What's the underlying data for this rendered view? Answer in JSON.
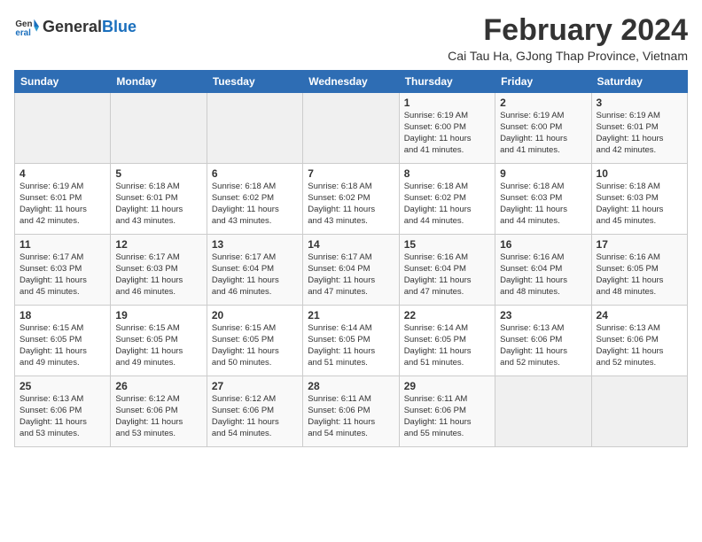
{
  "logo": {
    "general": "General",
    "blue": "Blue"
  },
  "title": "February 2024",
  "subtitle": "Cai Tau Ha, GJong Thap Province, Vietnam",
  "days_of_week": [
    "Sunday",
    "Monday",
    "Tuesday",
    "Wednesday",
    "Thursday",
    "Friday",
    "Saturday"
  ],
  "weeks": [
    [
      {
        "day": "",
        "info": ""
      },
      {
        "day": "",
        "info": ""
      },
      {
        "day": "",
        "info": ""
      },
      {
        "day": "",
        "info": ""
      },
      {
        "day": "1",
        "info": "Sunrise: 6:19 AM\nSunset: 6:00 PM\nDaylight: 11 hours\nand 41 minutes."
      },
      {
        "day": "2",
        "info": "Sunrise: 6:19 AM\nSunset: 6:00 PM\nDaylight: 11 hours\nand 41 minutes."
      },
      {
        "day": "3",
        "info": "Sunrise: 6:19 AM\nSunset: 6:01 PM\nDaylight: 11 hours\nand 42 minutes."
      }
    ],
    [
      {
        "day": "4",
        "info": "Sunrise: 6:19 AM\nSunset: 6:01 PM\nDaylight: 11 hours\nand 42 minutes."
      },
      {
        "day": "5",
        "info": "Sunrise: 6:18 AM\nSunset: 6:01 PM\nDaylight: 11 hours\nand 43 minutes."
      },
      {
        "day": "6",
        "info": "Sunrise: 6:18 AM\nSunset: 6:02 PM\nDaylight: 11 hours\nand 43 minutes."
      },
      {
        "day": "7",
        "info": "Sunrise: 6:18 AM\nSunset: 6:02 PM\nDaylight: 11 hours\nand 43 minutes."
      },
      {
        "day": "8",
        "info": "Sunrise: 6:18 AM\nSunset: 6:02 PM\nDaylight: 11 hours\nand 44 minutes."
      },
      {
        "day": "9",
        "info": "Sunrise: 6:18 AM\nSunset: 6:03 PM\nDaylight: 11 hours\nand 44 minutes."
      },
      {
        "day": "10",
        "info": "Sunrise: 6:18 AM\nSunset: 6:03 PM\nDaylight: 11 hours\nand 45 minutes."
      }
    ],
    [
      {
        "day": "11",
        "info": "Sunrise: 6:17 AM\nSunset: 6:03 PM\nDaylight: 11 hours\nand 45 minutes."
      },
      {
        "day": "12",
        "info": "Sunrise: 6:17 AM\nSunset: 6:03 PM\nDaylight: 11 hours\nand 46 minutes."
      },
      {
        "day": "13",
        "info": "Sunrise: 6:17 AM\nSunset: 6:04 PM\nDaylight: 11 hours\nand 46 minutes."
      },
      {
        "day": "14",
        "info": "Sunrise: 6:17 AM\nSunset: 6:04 PM\nDaylight: 11 hours\nand 47 minutes."
      },
      {
        "day": "15",
        "info": "Sunrise: 6:16 AM\nSunset: 6:04 PM\nDaylight: 11 hours\nand 47 minutes."
      },
      {
        "day": "16",
        "info": "Sunrise: 6:16 AM\nSunset: 6:04 PM\nDaylight: 11 hours\nand 48 minutes."
      },
      {
        "day": "17",
        "info": "Sunrise: 6:16 AM\nSunset: 6:05 PM\nDaylight: 11 hours\nand 48 minutes."
      }
    ],
    [
      {
        "day": "18",
        "info": "Sunrise: 6:15 AM\nSunset: 6:05 PM\nDaylight: 11 hours\nand 49 minutes."
      },
      {
        "day": "19",
        "info": "Sunrise: 6:15 AM\nSunset: 6:05 PM\nDaylight: 11 hours\nand 49 minutes."
      },
      {
        "day": "20",
        "info": "Sunrise: 6:15 AM\nSunset: 6:05 PM\nDaylight: 11 hours\nand 50 minutes."
      },
      {
        "day": "21",
        "info": "Sunrise: 6:14 AM\nSunset: 6:05 PM\nDaylight: 11 hours\nand 51 minutes."
      },
      {
        "day": "22",
        "info": "Sunrise: 6:14 AM\nSunset: 6:05 PM\nDaylight: 11 hours\nand 51 minutes."
      },
      {
        "day": "23",
        "info": "Sunrise: 6:13 AM\nSunset: 6:06 PM\nDaylight: 11 hours\nand 52 minutes."
      },
      {
        "day": "24",
        "info": "Sunrise: 6:13 AM\nSunset: 6:06 PM\nDaylight: 11 hours\nand 52 minutes."
      }
    ],
    [
      {
        "day": "25",
        "info": "Sunrise: 6:13 AM\nSunset: 6:06 PM\nDaylight: 11 hours\nand 53 minutes."
      },
      {
        "day": "26",
        "info": "Sunrise: 6:12 AM\nSunset: 6:06 PM\nDaylight: 11 hours\nand 53 minutes."
      },
      {
        "day": "27",
        "info": "Sunrise: 6:12 AM\nSunset: 6:06 PM\nDaylight: 11 hours\nand 54 minutes."
      },
      {
        "day": "28",
        "info": "Sunrise: 6:11 AM\nSunset: 6:06 PM\nDaylight: 11 hours\nand 54 minutes."
      },
      {
        "day": "29",
        "info": "Sunrise: 6:11 AM\nSunset: 6:06 PM\nDaylight: 11 hours\nand 55 minutes."
      },
      {
        "day": "",
        "info": ""
      },
      {
        "day": "",
        "info": ""
      }
    ]
  ]
}
